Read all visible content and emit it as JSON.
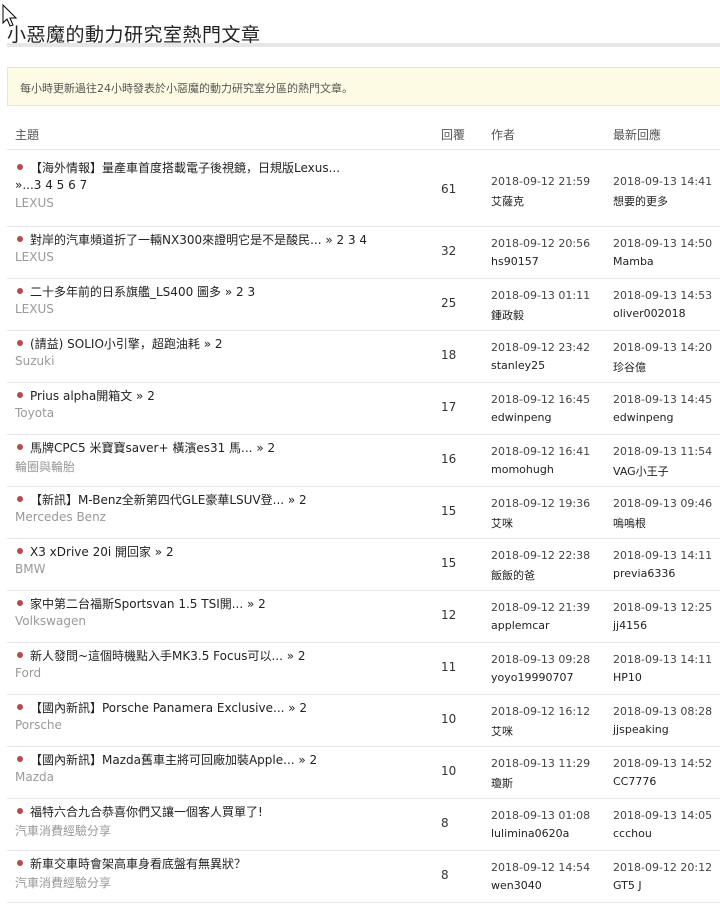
{
  "page": {
    "title": "小惡魔的動力研究室熱門文章",
    "notice": "每小時更新過往24小時發表於小惡魔的動力研究室分區的熱門文章。"
  },
  "table": {
    "headers": {
      "topic": "主題",
      "replies": "回覆",
      "author": "作者",
      "last_reply": "最新回應"
    },
    "rows": [
      {
        "title": "【海外情報】量產車首度搭載電子後視鏡，日規版Lexus...",
        "title_cont": "»...3 4 5 6 7",
        "forum": "LEXUS",
        "replies": "61",
        "post_date": "2018-09-12 21:59",
        "author": "艾薩克",
        "last_date": "2018-09-13 14:41",
        "last_user": "想要的更多"
      },
      {
        "title": "對岸的汽車頻道折了一輛NX300來證明它是不是酸民... » 2  3  4",
        "forum": "LEXUS",
        "replies": "32",
        "post_date": "2018-09-12 20:56",
        "author": "hs90157",
        "last_date": "2018-09-13 14:50",
        "last_user": "Mamba"
      },
      {
        "title": "二十多年前的日系旗艦_LS400 圖多 » 2  3",
        "forum": "LEXUS",
        "replies": "25",
        "post_date": "2018-09-13 01:11",
        "author": "鍾政毅",
        "last_date": "2018-09-13 14:53",
        "last_user": "oliver002018"
      },
      {
        "title": "(請益) SOLIO小引擎，超跑油耗 » 2",
        "forum": "Suzuki",
        "replies": "18",
        "post_date": "2018-09-12 23:42",
        "author": "stanley25",
        "last_date": "2018-09-13 14:20",
        "last_user": "珍谷億"
      },
      {
        "title": "Prius alpha開箱文 » 2",
        "forum": "Toyota",
        "replies": "17",
        "post_date": "2018-09-12 16:45",
        "author": "edwinpeng",
        "last_date": "2018-09-13 14:45",
        "last_user": "edwinpeng"
      },
      {
        "title": "馬牌CPC5 米寶寶saver+ 橫濱es31 馬... » 2",
        "forum": "輪圈與輪胎",
        "replies": "16",
        "post_date": "2018-09-12 16:41",
        "author": "momohugh",
        "last_date": "2018-09-13 11:54",
        "last_user": "VAG小王子"
      },
      {
        "title": "【新訊】M-Benz全新第四代GLE豪華LSUV登... » 2",
        "forum": "Mercedes Benz",
        "replies": "15",
        "post_date": "2018-09-12 19:36",
        "author": "艾咪",
        "last_date": "2018-09-13 09:46",
        "last_user": "嗚嗚根"
      },
      {
        "title": "X3 xDrive 20i 開回家 » 2",
        "forum": "BMW",
        "replies": "15",
        "post_date": "2018-09-12 22:38",
        "author": "飯飯的爸",
        "last_date": "2018-09-13 14:11",
        "last_user": "previa6336"
      },
      {
        "title": "家中第二台福斯Sportsvan 1.5 TSI開... » 2",
        "forum": "Volkswagen",
        "replies": "12",
        "post_date": "2018-09-12 21:39",
        "author": "applemcar",
        "last_date": "2018-09-13 12:25",
        "last_user": "jj4156"
      },
      {
        "title": "新人發問~這個時機點入手MK3.5 Focus可以... » 2",
        "forum": "Ford",
        "replies": "11",
        "post_date": "2018-09-13 09:28",
        "author": "yoyo19990707",
        "last_date": "2018-09-13 14:11",
        "last_user": "HP10"
      },
      {
        "title": "【國內新訊】Porsche Panamera Exclusive... » 2",
        "forum": "Porsche",
        "replies": "10",
        "post_date": "2018-09-12 16:12",
        "author": "艾咪",
        "last_date": "2018-09-13 08:28",
        "last_user": "jjspeaking"
      },
      {
        "title": "【國內新訊】Mazda舊車主將可回廠加裝Apple... » 2",
        "forum": "Mazda",
        "replies": "10",
        "post_date": "2018-09-13 11:29",
        "author": "瓊斯",
        "last_date": "2018-09-13 14:52",
        "last_user": "CC7776"
      },
      {
        "title": "福特六合九合恭喜你們又讓一個客人買單了!",
        "forum": "汽車消費經驗分享",
        "replies": "8",
        "post_date": "2018-09-13 01:08",
        "author": "lulimina0620a",
        "last_date": "2018-09-13 14:05",
        "last_user": "ccchou"
      },
      {
        "title": "新車交車時會架高車身看底盤有無異狀？",
        "forum": "汽車消費經驗分享",
        "replies": "8",
        "post_date": "2018-09-12 14:54",
        "author": "wen3040",
        "last_date": "2018-09-12 20:12",
        "last_user": "GT5 J"
      }
    ]
  },
  "colors": {
    "bullet": "#b84a4a",
    "notice_bg": "#fdfbe3",
    "forum_text": "#999999"
  },
  "icons": {
    "cursor": "mouse-pointer-icon",
    "bullet": "bullet-dot-icon"
  }
}
